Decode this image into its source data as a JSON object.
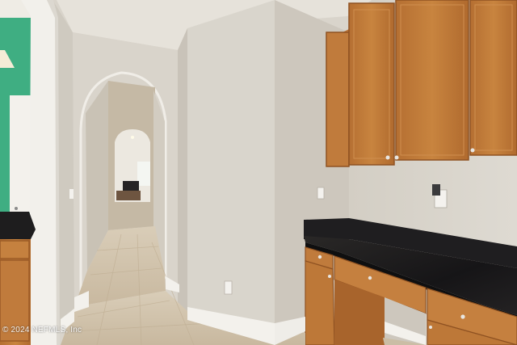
{
  "photo": {
    "watermark": "© 2024 NEFMLS, Inc"
  },
  "colors": {
    "wall": "#d8d3ca",
    "wall_shadow": "#c6c0b6",
    "ceiling": "#e7e3dc",
    "floor": "#cdbfa8",
    "cabinet_wood": "#c07b3c",
    "cabinet_dark": "#9a5a26",
    "granite": "#1c1b1d",
    "trim": "#f3f1ec",
    "green_wall": "#3fae82"
  }
}
